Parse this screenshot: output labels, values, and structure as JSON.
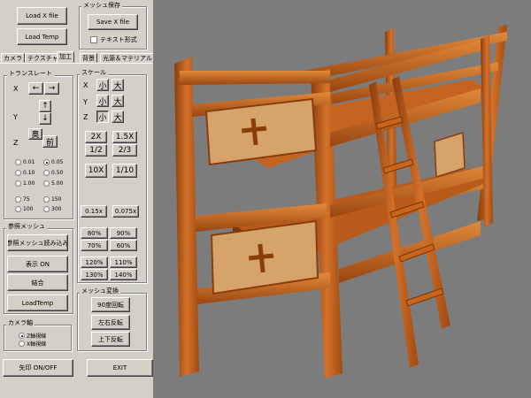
{
  "file": {
    "load_x": "Load X file",
    "load_temp": "Load Temp"
  },
  "save_group": {
    "title": "メッシュ保存",
    "save_x": "Save X file",
    "text_format": "テキスト形式"
  },
  "tabs": [
    "カメラ",
    "テクスチャ",
    "加工",
    "背景",
    "光源＆マテリアル"
  ],
  "translate": {
    "title": "トランスレート",
    "x": "X",
    "y": "Y",
    "z": "Z",
    "left": "←",
    "right": "→",
    "up": "↑",
    "down": "↓",
    "back": "奥",
    "front": "前",
    "steps": [
      [
        "0.01",
        "0.05"
      ],
      [
        "0.10",
        "0.50"
      ],
      [
        "1.00",
        "5.00"
      ],
      [
        "75",
        "150"
      ],
      [
        "100",
        "300"
      ]
    ],
    "selected": "0.05"
  },
  "scale": {
    "title": "スケール",
    "x": "X",
    "y": "Y",
    "z": "Z",
    "small": "小",
    "large": "大",
    "ratios": [
      "2X",
      "1.5X",
      "1/2",
      "2/3",
      "10X",
      "1/10",
      "0.15x",
      "0.075x"
    ],
    "percents": [
      "80%",
      "90%",
      "70%",
      "60%",
      "120%",
      "110%",
      "130%",
      "140%"
    ]
  },
  "ref_mesh": {
    "title": "参照メッシュ",
    "load": "参照メッシュ読み込み",
    "display": "表示 ON",
    "join": "結合",
    "load_temp": "LoadTemp"
  },
  "transform": {
    "title": "メッシュ変換",
    "rot90": "90度回転",
    "flip_lr": "左右反転",
    "flip_ud": "上下反転"
  },
  "camera_axis": {
    "title": "カメラ軸",
    "z": "Z軸視線",
    "x": "X軸視線",
    "selected": "Z軸視線"
  },
  "bottom": {
    "arrow": "矢印 ON/OFF",
    "exit": "EXIT"
  },
  "viewport": {
    "background": "#7c7c7c",
    "wood": "#c8651a",
    "wood_dark": "#8a3d0c",
    "wood_light": "#e08a3a",
    "panel": "#d6a46a"
  }
}
